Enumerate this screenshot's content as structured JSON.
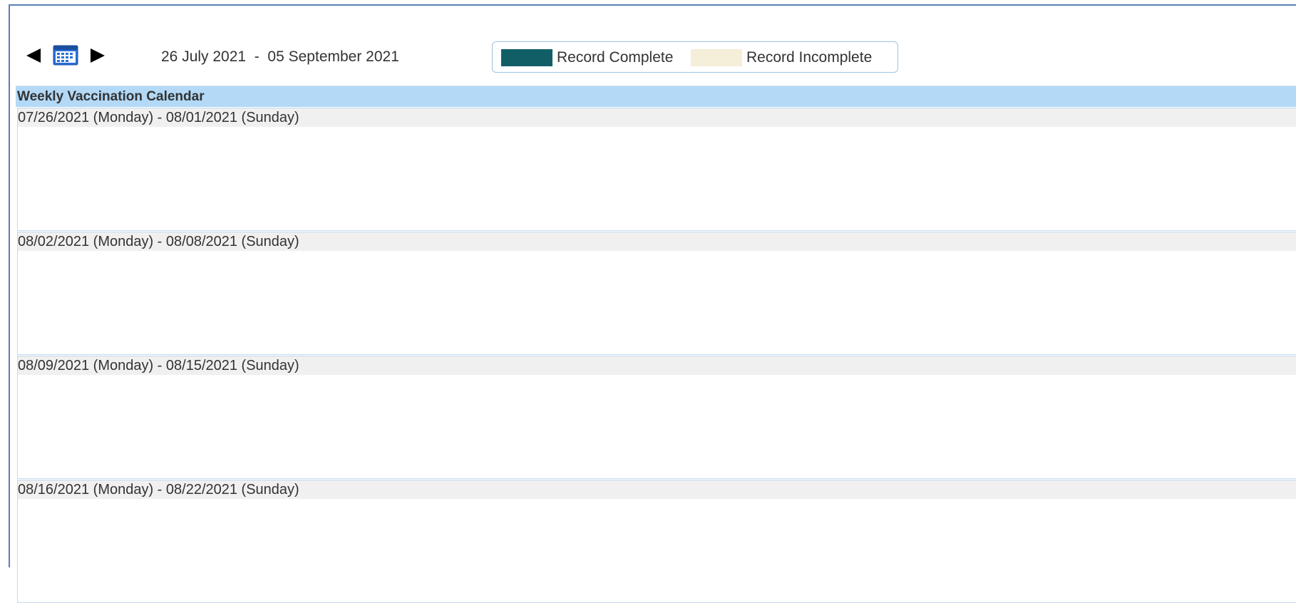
{
  "toolbar": {
    "prev_icon": "left-triangle-icon",
    "calendar_icon": "calendar-icon",
    "next_icon": "right-triangle-icon",
    "date_range": "26 July 2021  -  05 September 2021"
  },
  "legend": {
    "items": [
      {
        "label": "Record Complete",
        "color": "#125e66"
      },
      {
        "label": "Record Incomplete",
        "color": "#f5eed8"
      }
    ]
  },
  "calendar": {
    "title": "Weekly Vaccination Calendar",
    "header_color": "#b3d9f7",
    "weeks": [
      {
        "label": "07/26/2021 (Monday) - 08/01/2021 (Sunday)"
      },
      {
        "label": "08/02/2021 (Monday) - 08/08/2021 (Sunday)"
      },
      {
        "label": "08/09/2021 (Monday) - 08/15/2021 (Sunday)"
      },
      {
        "label": "08/16/2021 (Monday) - 08/22/2021 (Sunday)"
      }
    ]
  }
}
